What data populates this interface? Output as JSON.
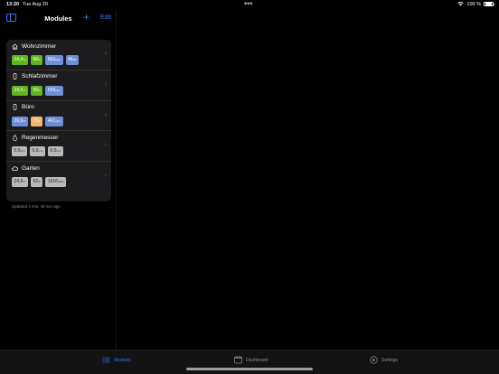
{
  "status": {
    "time": "13:20",
    "date": "Tue Aug 20",
    "battery": "100 %"
  },
  "nav": {
    "title": "Modules",
    "add_label": "+",
    "edit_label": "Edit"
  },
  "modules": [
    {
      "name": "Wohnzimmer",
      "icon": "house-icon",
      "values": [
        {
          "v": "24,4",
          "u": "°C",
          "color": "green"
        },
        {
          "v": "60",
          "u": "%",
          "color": "green"
        },
        {
          "v": "663",
          "u": "ppm",
          "color": "blue"
        },
        {
          "v": "46",
          "u": "dB",
          "color": "blue"
        }
      ]
    },
    {
      "name": "Schlafzimmer",
      "icon": "sensor-icon",
      "values": [
        {
          "v": "24,5",
          "u": "°C",
          "color": "green"
        },
        {
          "v": "55",
          "u": "%",
          "color": "green"
        },
        {
          "v": "559",
          "u": "ppm",
          "color": "blue"
        }
      ]
    },
    {
      "name": "Büro",
      "icon": "sensor-icon",
      "values": [
        {
          "v": "20,9",
          "u": "°C",
          "color": "blue"
        },
        {
          "v": "77",
          "u": "%",
          "color": "orange"
        },
        {
          "v": "467",
          "u": "ppm",
          "color": "blue"
        }
      ]
    },
    {
      "name": "Regenmesser",
      "icon": "drop-icon",
      "values": [
        {
          "v": "0,0",
          "u": "mm",
          "color": "gray"
        },
        {
          "v": "0,0",
          "u": "mm",
          "color": "gray"
        },
        {
          "v": "0,0",
          "u": "mm",
          "color": "gray"
        }
      ]
    },
    {
      "name": "Garten",
      "icon": "cloud-icon",
      "values": [
        {
          "v": "24,5",
          "u": "°C",
          "color": "gray"
        },
        {
          "v": "62",
          "u": "%",
          "color": "gray"
        },
        {
          "v": "1016",
          "u": "mbar",
          "color": "gray"
        }
      ]
    }
  ],
  "updated": "Updated 3 min, 45 sec ago",
  "tabs": [
    {
      "label": "Modules",
      "icon": "list-icon",
      "active": true
    },
    {
      "label": "Dashboard",
      "icon": "dashboard-icon",
      "active": false
    },
    {
      "label": "Settings",
      "icon": "settings-icon",
      "active": false
    }
  ],
  "colors": {
    "accent": "#2f7cf6",
    "green": "#5fb71c",
    "blue": "#6f8ed8",
    "orange": "#f2b56b",
    "gray": "#b9b9b9"
  }
}
